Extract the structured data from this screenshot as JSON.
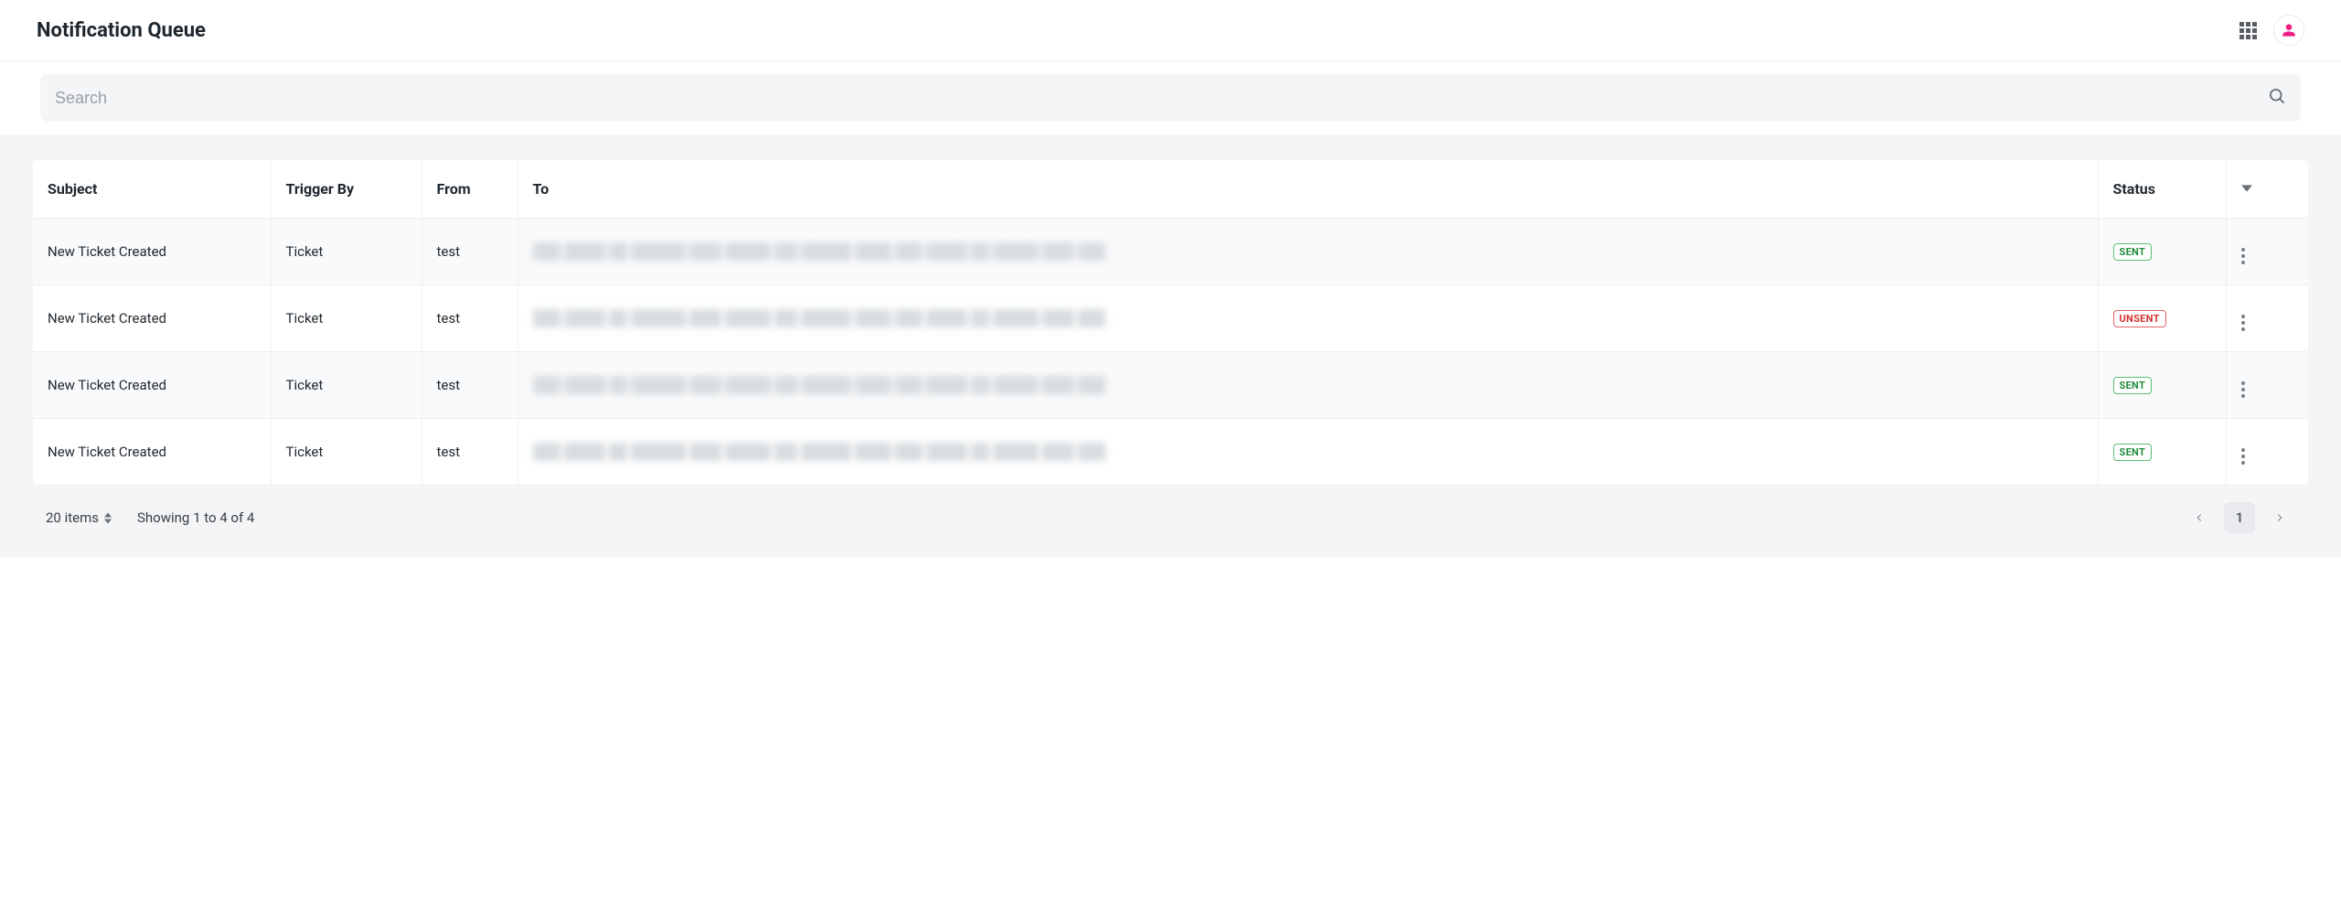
{
  "header": {
    "title": "Notification Queue"
  },
  "search": {
    "placeholder": "Search",
    "value": ""
  },
  "table": {
    "columns": {
      "subject": "Subject",
      "trigger_by": "Trigger By",
      "from": "From",
      "to": "To",
      "status": "Status"
    },
    "rows": [
      {
        "subject": "New Ticket Created",
        "trigger_by": "Ticket",
        "from": "test",
        "to_redacted": true,
        "status": "SENT",
        "status_type": "sent"
      },
      {
        "subject": "New Ticket Created",
        "trigger_by": "Ticket",
        "from": "test",
        "to_redacted": true,
        "status": "UNSENT",
        "status_type": "unsent"
      },
      {
        "subject": "New Ticket Created",
        "trigger_by": "Ticket",
        "from": "test",
        "to_redacted": true,
        "status": "SENT",
        "status_type": "sent"
      },
      {
        "subject": "New Ticket Created",
        "trigger_by": "Ticket",
        "from": "test",
        "to_redacted": true,
        "status": "SENT",
        "status_type": "sent"
      }
    ]
  },
  "footer": {
    "page_size_label": "20 items",
    "showing_text": "Showing 1 to 4 of 4",
    "current_page": "1"
  }
}
